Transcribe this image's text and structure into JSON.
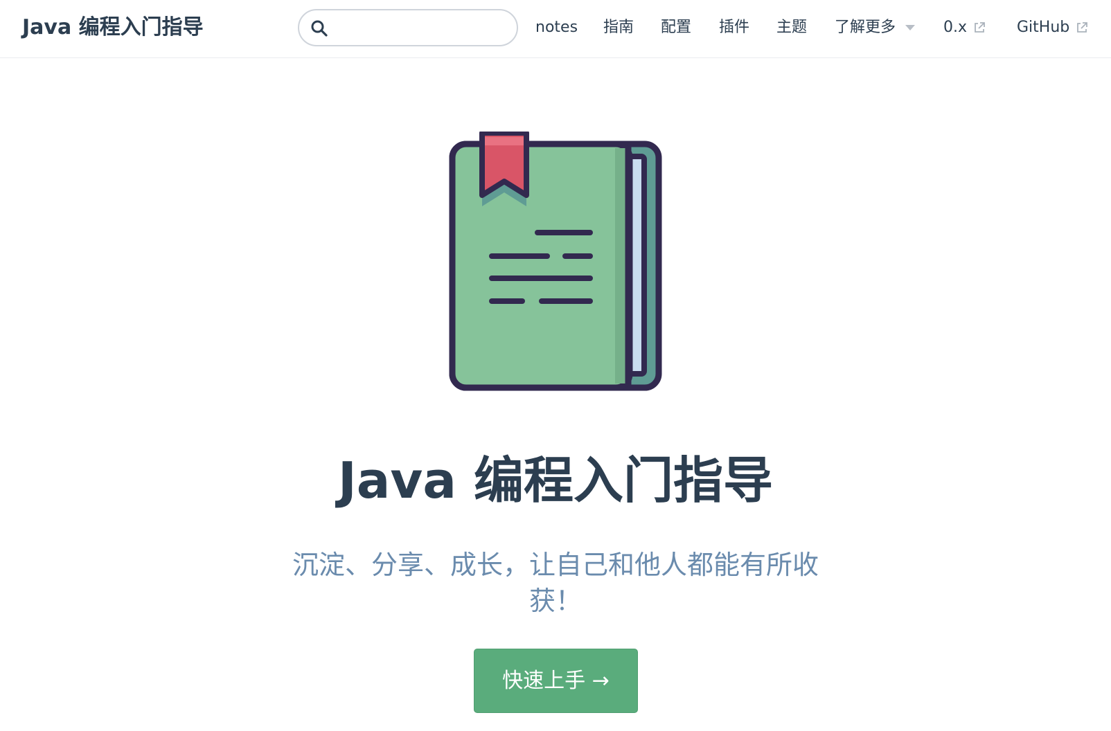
{
  "navbar": {
    "site_name": "Java 编程入门指导",
    "search": {
      "value": "",
      "placeholder": ""
    },
    "links": [
      {
        "label": "notes"
      },
      {
        "label": "指南"
      },
      {
        "label": "配置"
      },
      {
        "label": "插件"
      },
      {
        "label": "主题"
      },
      {
        "label": "了解更多",
        "icon": "caret-down-icon"
      },
      {
        "label": "0.x",
        "icon": "external-link-icon"
      },
      {
        "label": "GitHub",
        "icon": "external-link-icon"
      }
    ]
  },
  "hero": {
    "image": "book-with-bookmark-icon",
    "title": "Java 编程入门指导",
    "description": "沉淀、分享、成长，让自己和他人都能有所收获！",
    "action_label": "快速上手 →"
  },
  "colors": {
    "accent": "#5aac7c",
    "title_text": "#2c3e50",
    "description_text": "#6a8bad",
    "book_cover": "#86c39a",
    "book_spine": "#5f9c94",
    "book_outline": "#32294f",
    "bookmark": "#d95567"
  }
}
